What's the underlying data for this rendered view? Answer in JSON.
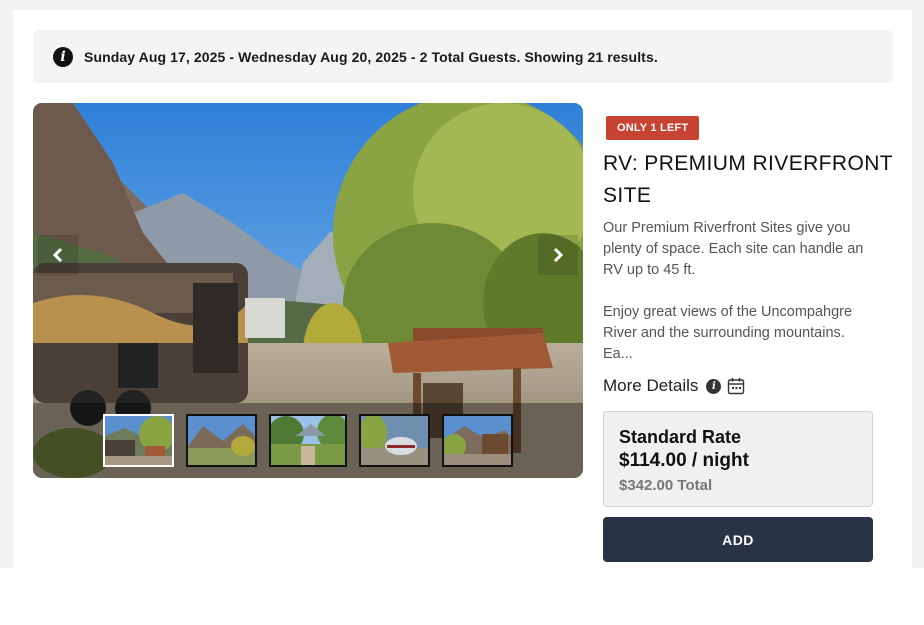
{
  "info_bar": {
    "icon": "info-circle-icon",
    "text": "Sunday Aug 17, 2025 - Wednesday Aug 20, 2025 - 2 Total Guests. Showing 21 results."
  },
  "gallery": {
    "prev_icon": "chevron-left-icon",
    "next_icon": "chevron-right-icon",
    "thumbnail_count": 5,
    "active_thumbnail": 1
  },
  "listing": {
    "badge": "ONLY 1 LEFT",
    "title": "RV: PREMIUM RIVERFRONT SITE",
    "description": "Our Premium Riverfront Sites give you plenty of space. Each site can handle an RV up to 45 ft.\n\nEnjoy great views of the Uncompahgre River and the surrounding mountains. Ea...",
    "more_details_label": "More Details",
    "more_details_icons": [
      "info-circle-icon",
      "calendar-icon"
    ]
  },
  "rate": {
    "name": "Standard Rate",
    "price": "$114.00 / night",
    "total": "$342.00 Total"
  },
  "actions": {
    "add_label": "ADD"
  },
  "colors": {
    "badge": "#c84432",
    "add_button": "#283346",
    "info_bar_bg": "#f3f4f6",
    "rate_box_bg": "#eef0f2"
  }
}
